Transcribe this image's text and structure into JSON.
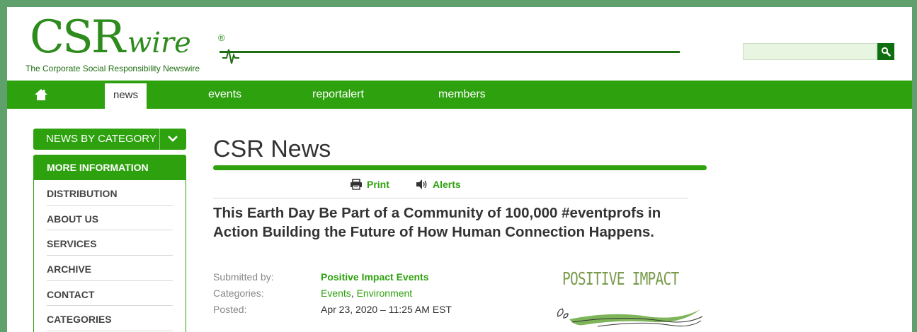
{
  "brand": {
    "logo_main": "CSR",
    "logo_wire": "wire",
    "logo_registered": "®",
    "tagline": "The Corporate Social Responsibility Newswire",
    "color": "#2e8b1e"
  },
  "search": {
    "value": "",
    "placeholder": "",
    "icon": "search-icon"
  },
  "nav": {
    "home_icon": "home-icon",
    "tabs": [
      {
        "label": "news",
        "active": true
      },
      {
        "label": "events",
        "active": false
      },
      {
        "label": "reportalert",
        "active": false
      },
      {
        "label": "members",
        "active": false
      }
    ],
    "color": "#2ea10e"
  },
  "sidebar": {
    "category_button": "NEWS BY CATEGORY",
    "more_heading": "MORE INFORMATION",
    "items": [
      "DISTRIBUTION",
      "ABOUT US",
      "SERVICES",
      "ARCHIVE",
      "CONTACT",
      "CATEGORIES"
    ]
  },
  "main": {
    "title": "CSR News",
    "tools": {
      "print": "Print",
      "alerts": "Alerts"
    },
    "headline": "This Earth Day Be Part of a Community of 100,000 #eventprofs in Action Building the Future of How Human Connection Happens.",
    "meta": {
      "submitted_label": "Submitted by:",
      "submitted_value": "Positive Impact Events",
      "categories_label": "Categories:",
      "categories": [
        "Events",
        "Environment"
      ],
      "categories_sep": ",",
      "posted_label": "Posted:",
      "posted_value": "Apr 23, 2020 – 11:25 AM EST"
    },
    "org_logo_text": "POSITIVE IMPACT"
  }
}
